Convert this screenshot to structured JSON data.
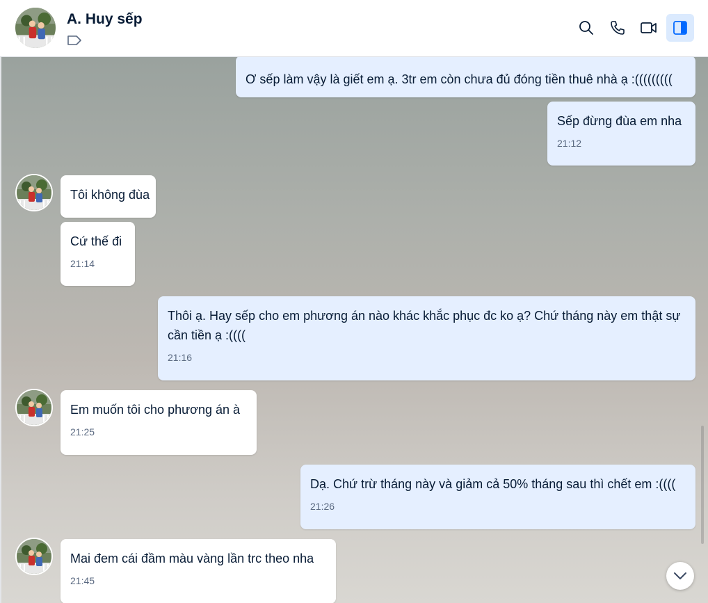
{
  "header": {
    "contact_name": "A. Huy sếp",
    "icons": [
      "tag-icon",
      "search-icon",
      "phone-icon",
      "video-call-icon",
      "side-panel-icon"
    ]
  },
  "messages": [
    {
      "side": "sent",
      "text": "Ơ sếp làm vậy là giết em ạ. 3tr em còn chưa đủ đóng tiền thuê nhà ạ :(((((((((",
      "time": ""
    },
    {
      "side": "sent",
      "text": "Sếp đừng đùa em nha",
      "time": "21:12"
    },
    {
      "side": "recv",
      "text": "Tôi không đùa",
      "time": ""
    },
    {
      "side": "recv",
      "text": "Cứ thế đi",
      "time": "21:14"
    },
    {
      "side": "sent",
      "text": "Thôi ạ. Hay sếp cho em phương án nào khác khắc phục đc ko ạ? Chứ tháng này em thật sự cần tiền ạ :((((",
      "time": "21:16"
    },
    {
      "side": "recv",
      "text": "Em muốn tôi cho phương án à",
      "time": "21:25"
    },
    {
      "side": "sent",
      "text": "Dạ. Chứ trừ tháng này và giảm cả 50% tháng sau thì chết em :((((",
      "time": "21:26"
    },
    {
      "side": "recv",
      "text": "Mai đem cái đầm màu vàng lần trc theo nha",
      "time": "21:45"
    }
  ],
  "colors": {
    "sent_bubble": "#e5efff",
    "received_bubble": "#ffffff",
    "active_button": "#dbeafe",
    "accent": "#0068ff"
  }
}
